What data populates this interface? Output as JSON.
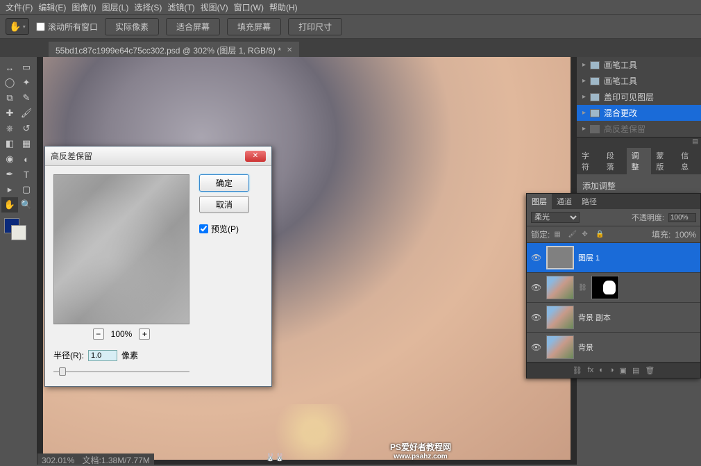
{
  "menu": [
    "文件(F)",
    "编辑(E)",
    "图像(I)",
    "图层(L)",
    "选择(S)",
    "滤镜(T)",
    "视图(V)",
    "窗口(W)",
    "帮助(H)"
  ],
  "options": {
    "scroll_all": "滚动所有窗口",
    "buttons": [
      "实际像素",
      "适合屏幕",
      "填充屏幕",
      "打印尺寸"
    ]
  },
  "doc_tab": {
    "title": "55bd1c87c1999e64c75cc302.psd @ 302% (图层 1, RGB/8) *"
  },
  "dialog": {
    "title": "高反差保留",
    "ok": "确定",
    "cancel": "取消",
    "preview": "预览(P)",
    "zoom": "100%",
    "radius_label": "半径(R):",
    "radius_value": "1.0",
    "radius_unit": "像素"
  },
  "history": {
    "items": [
      "画笔工具",
      "画笔工具",
      "盖印可见图层",
      "混合更改",
      "高反差保留"
    ],
    "selected": 3
  },
  "right_tabs": [
    "字符",
    "段落",
    "调整",
    "蒙版",
    "信息"
  ],
  "adjustments": {
    "title": "添加调整"
  },
  "layers_panel": {
    "tabs": [
      "图层",
      "通道",
      "路径"
    ],
    "blend_mode": "柔光",
    "opacity_label": "不透明度:",
    "opacity": "100%",
    "lock_label": "锁定:",
    "fill_label": "填充:",
    "fill": "100%",
    "layers": [
      {
        "name": "图层 1",
        "sel": true,
        "thumb": "gray"
      },
      {
        "name": "",
        "thumb": "photo1",
        "mask": true
      },
      {
        "name": "背景 副本",
        "thumb": "photo1"
      },
      {
        "name": "背景",
        "thumb": "photo1"
      }
    ]
  },
  "watermark": {
    "title": "PS爱好者教程网",
    "url": "www.psahz.com"
  },
  "status": {
    "zoom": "302.01%",
    "info": "文档:1.38M/7.77M"
  }
}
